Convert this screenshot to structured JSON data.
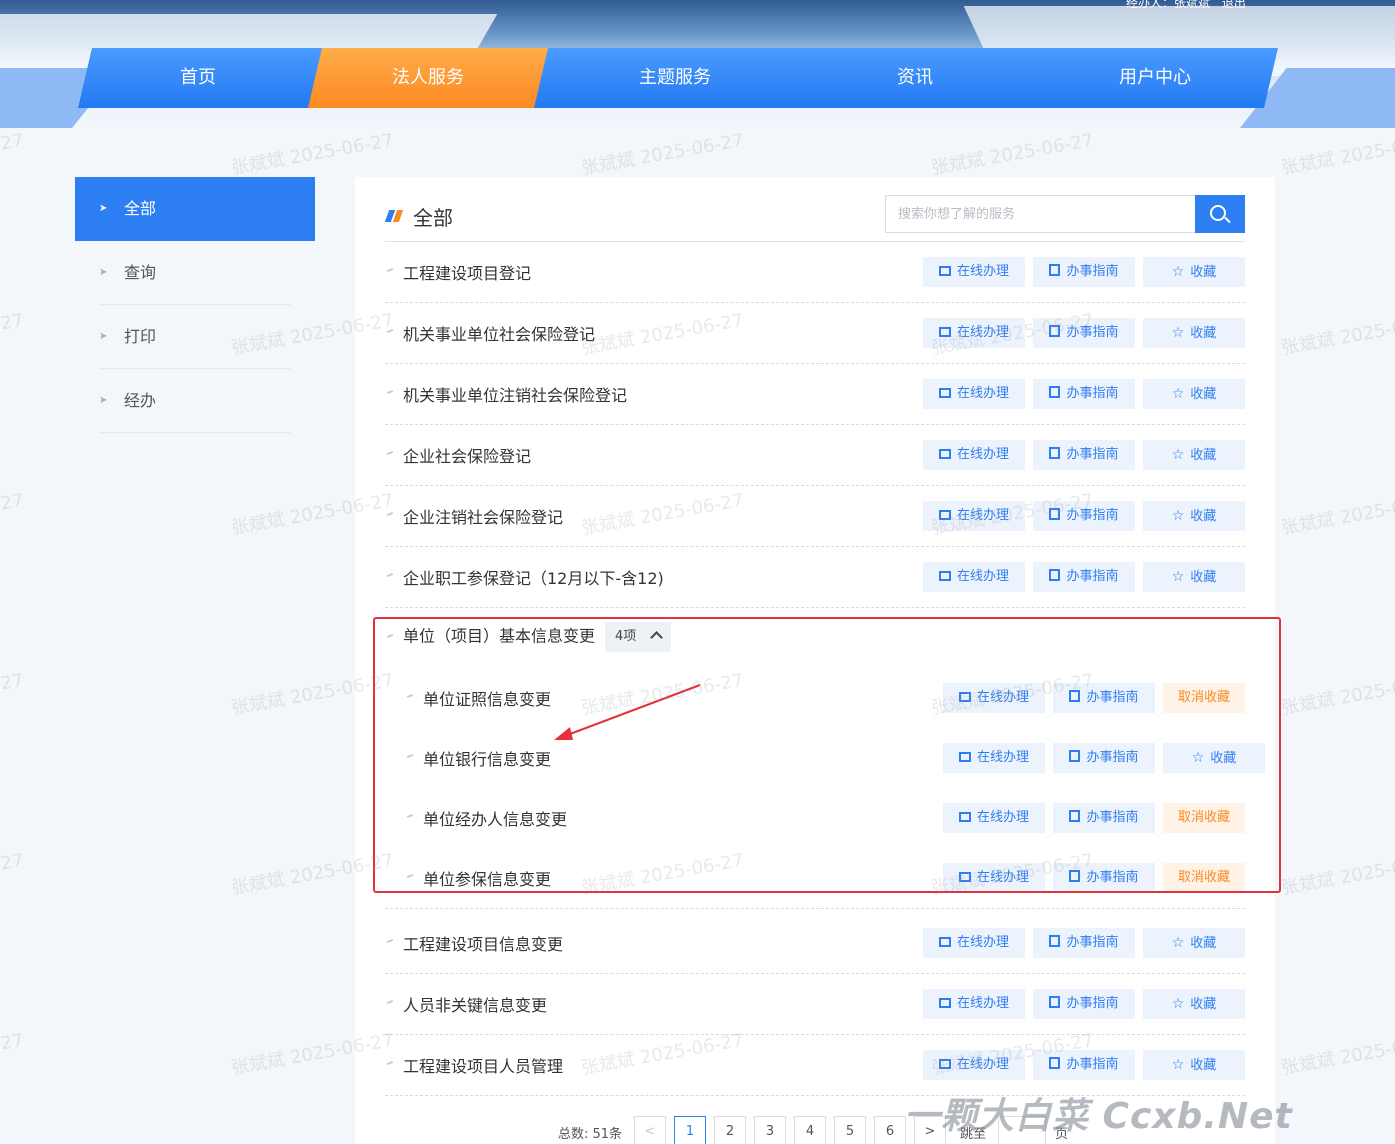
{
  "header": {
    "user_label": "经办人：张斌斌",
    "logout_label": "退出"
  },
  "nav": [
    "首页",
    "法人服务",
    "主题服务",
    "资讯",
    "用户中心"
  ],
  "sidebar": [
    "全部",
    "查询",
    "打印",
    "经办"
  ],
  "main": {
    "title": "全部",
    "search_placeholder": "搜索你想了解的服务"
  },
  "actions": {
    "online": "在线办理",
    "guide": "办事指南",
    "fav": "收藏",
    "unfav": "取消收藏"
  },
  "services": [
    {
      "name": "工程建设项目登记",
      "favorited": false
    },
    {
      "name": "机关事业单位社会保险登记",
      "favorited": false
    },
    {
      "name": "机关事业单位注销社会保险登记",
      "favorited": false
    },
    {
      "name": "企业社会保险登记",
      "favorited": false
    },
    {
      "name": "企业注销社会保险登记",
      "favorited": false
    },
    {
      "name": "企业职工参保登记（12月以下-含12)",
      "favorited": false
    }
  ],
  "group": {
    "name": "单位（项目）基本信息变更",
    "count_label": "4项",
    "children": [
      {
        "name": "单位证照信息变更",
        "favorited": true
      },
      {
        "name": "单位银行信息变更",
        "favorited": false
      },
      {
        "name": "单位经办人信息变更",
        "favorited": true
      },
      {
        "name": "单位参保信息变更",
        "favorited": true
      }
    ]
  },
  "services_after": [
    {
      "name": "工程建设项目信息变更",
      "favorited": false
    },
    {
      "name": "人员非关键信息变更",
      "favorited": false
    },
    {
      "name": "工程建设项目人员管理",
      "favorited": false
    }
  ],
  "pagination": {
    "total_label": "总数: 51条",
    "pages": [
      "1",
      "2",
      "3",
      "4",
      "5",
      "6"
    ],
    "current": "1",
    "prev": "<",
    "next": ">",
    "jump_label": "跳至",
    "page_unit": "页"
  },
  "watermark": "张斌斌 2025-06-27",
  "brand": "一颗大白菜 Ccxb.Net",
  "colors": {
    "primary": "#2e7ef3",
    "accent": "#fb8a22",
    "highlight": "#e5313c"
  }
}
